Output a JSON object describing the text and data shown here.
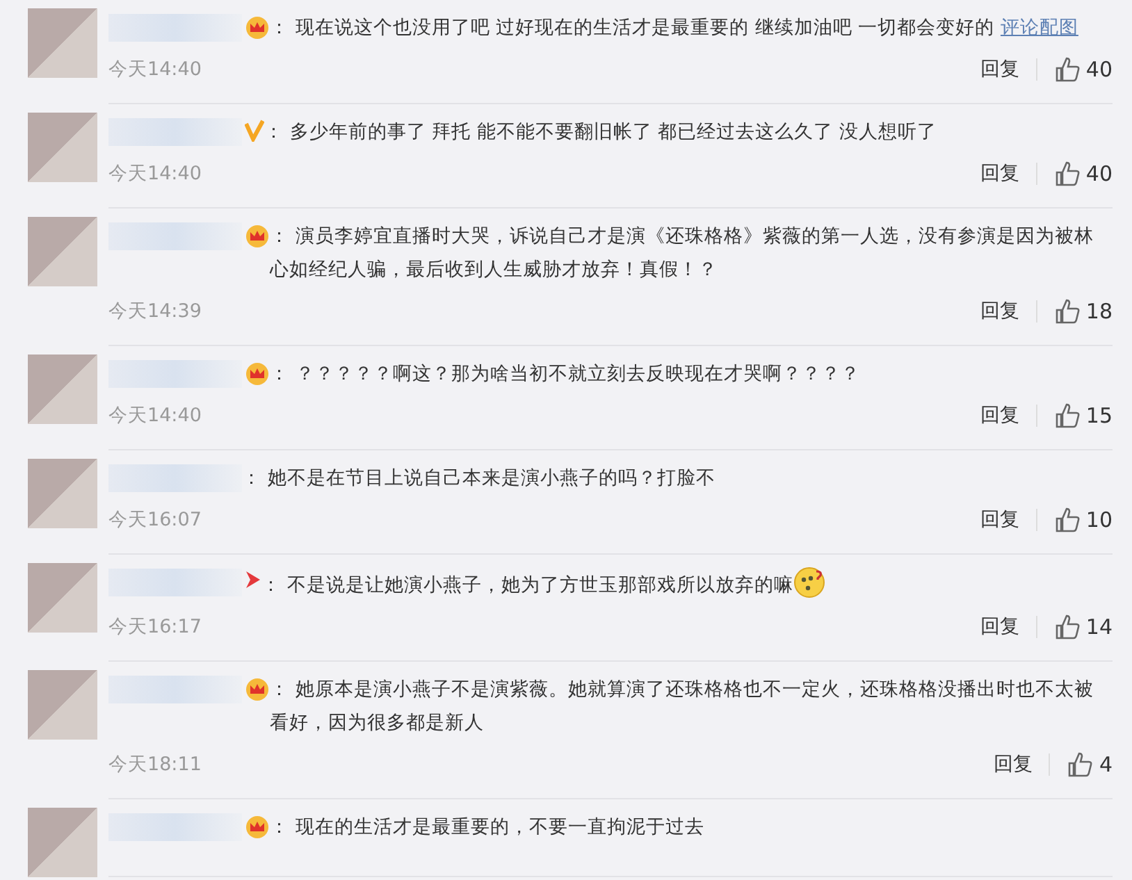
{
  "comments": [
    {
      "kind": "crown",
      "text": "：  现在说这个也没用了吧 过好现在的生活才是最重要的 继续加油吧 一切都会变好的",
      "link": "评论配图",
      "emoji": false,
      "time": "今天14:40",
      "reply": "回复",
      "likes": "40"
    },
    {
      "kind": "verified",
      "text": "：  多少年前的事了 拜托 能不能不要翻旧帐了 都已经过去这么久了 没人想听了",
      "emoji": false,
      "time": "今天14:40",
      "reply": "回复",
      "likes": "40"
    },
    {
      "kind": "crown",
      "text": "：  演员李婷宜直播时大哭，诉说自己才是演《还珠格格》紫薇的第一人选，没有参演是因为被林心如经纪人骗，最后收到人生威胁才放弃！真假！？",
      "emoji": false,
      "time": "今天14:39",
      "reply": "回复",
      "likes": "18"
    },
    {
      "kind": "crown",
      "text": "：  ？？？？？啊这？那为啥当初不就立刻去反映现在才哭啊？？？？",
      "emoji": false,
      "time": "今天14:40",
      "reply": "回复",
      "likes": "15"
    },
    {
      "kind": "none",
      "text": "：  她不是在节目上说自己本来是演小燕子的吗？打脸不",
      "emoji": false,
      "time": "今天16:07",
      "reply": "回复",
      "likes": "10"
    },
    {
      "kind": "arrow",
      "text": "：  不是说是让她演小燕子，她为了方世玉那部戏所以放弃的嘛",
      "emoji": true,
      "time": "今天16:17",
      "reply": "回复",
      "likes": "14"
    },
    {
      "kind": "crown",
      "text": "：  她原本是演小燕子不是演紫薇。她就算演了还珠格格也不一定火，还珠格格没播出时也不太被看好，因为很多都是新人",
      "emoji": false,
      "time": "今天18:11",
      "reply": "回复",
      "likes": "4"
    },
    {
      "kind": "crown",
      "text": "：  现在的生活才是最重要的，不要一直拘泥于过去",
      "emoji": false
    }
  ]
}
